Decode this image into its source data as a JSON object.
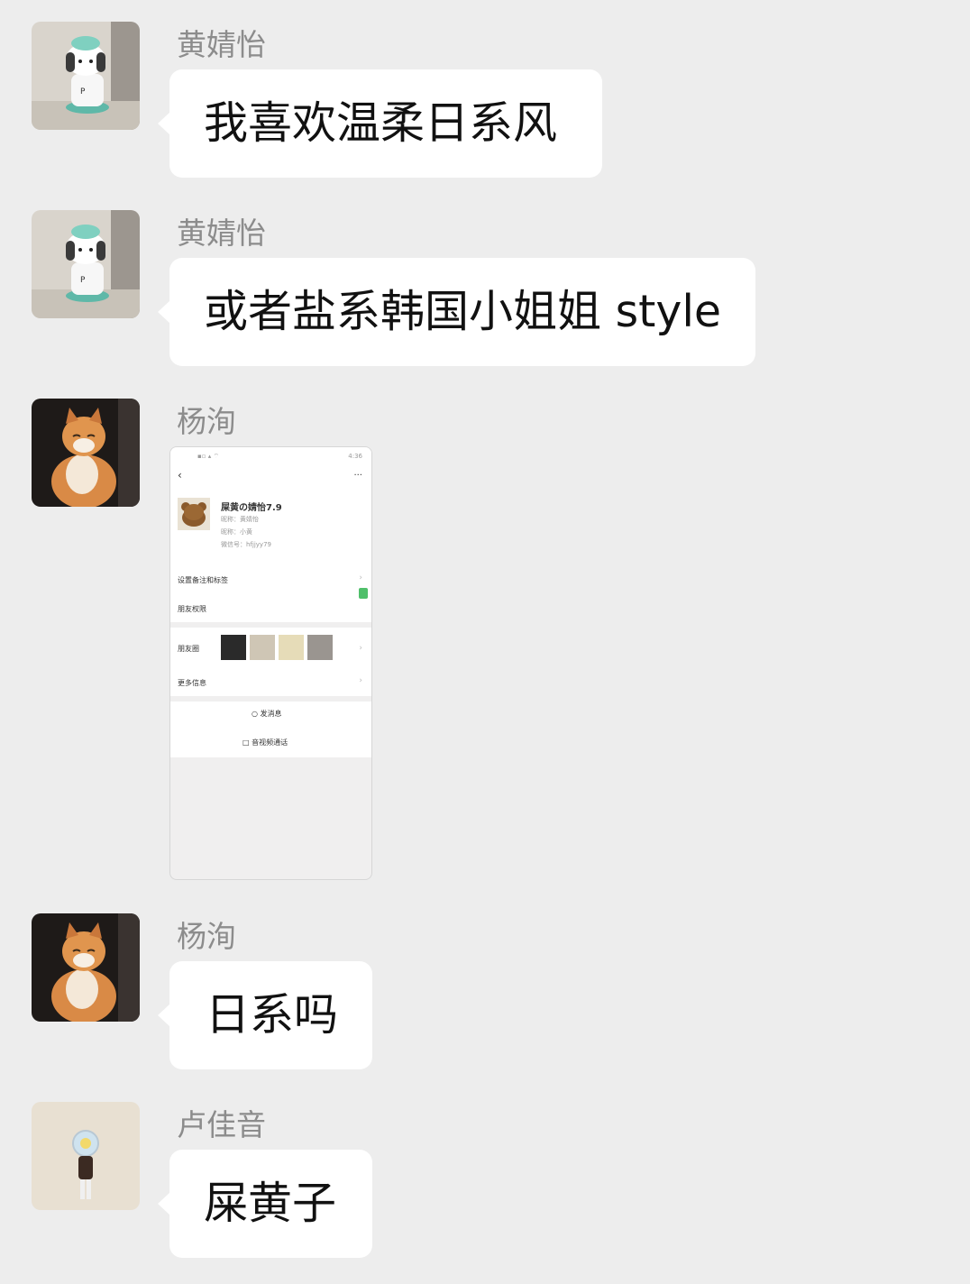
{
  "messages": [
    {
      "sender": "黄婧怡",
      "text": "我喜欢温柔日系风"
    },
    {
      "sender": "黄婧怡",
      "text": "或者盐系韩国小姐姐 style"
    },
    {
      "sender": "杨洵",
      "image": {
        "status_bar": "4:36",
        "more": "···",
        "profile_name": "屎黄の婧怡7.9",
        "remark": "昵称：黄婧怡",
        "nickname": "昵称：小黄",
        "wechat_id": "微信号：hfjjyy79",
        "row_tags": "设置备注和标签",
        "row_permissions": "朋友权限",
        "row_moments": "朋友圈",
        "row_more": "更多信息",
        "send_message": "发消息",
        "video_call": "音视频通话"
      }
    },
    {
      "sender": "杨洵",
      "text": "日系吗"
    },
    {
      "sender": "卢佳音",
      "text": "屎黄子"
    }
  ],
  "colors": {
    "background": "#ededed",
    "bubble": "#ffffff",
    "sender": "#8c8c8c"
  }
}
